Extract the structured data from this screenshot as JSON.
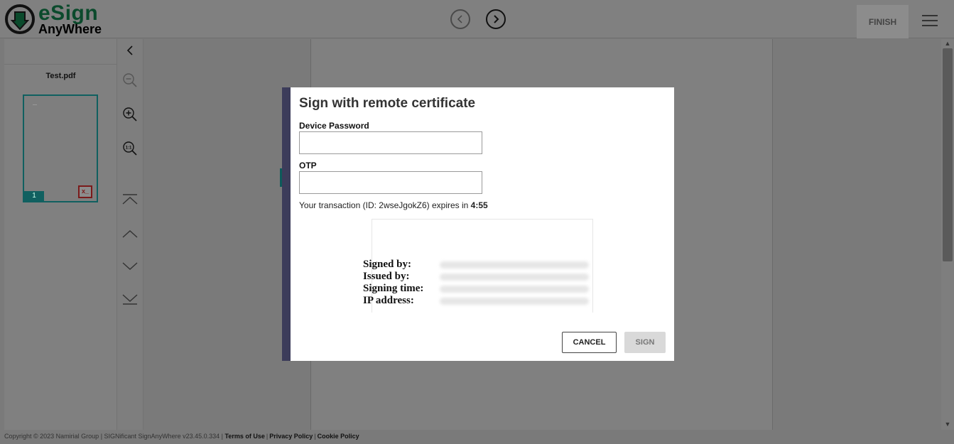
{
  "header": {
    "logo_line1": "eSign",
    "logo_line2": "AnyWhere",
    "finish_label": "FINISH"
  },
  "sidebar": {
    "file_name": "Test.pdf",
    "page_number": "1"
  },
  "icons": {
    "collapse": "chevron-left-icon",
    "zoom_out": "zoom-out-icon",
    "zoom_in": "zoom-in-icon",
    "zoom_reset": "zoom-reset-icon",
    "first_page": "first-page-icon",
    "prev_page": "chevron-up-icon",
    "next_page": "chevron-down-icon",
    "last_page": "last-page-icon"
  },
  "modal": {
    "title": "Sign with remote certificate",
    "password_label": "Device Password",
    "password_value": "",
    "otp_label": "OTP",
    "otp_value": "",
    "expiry_prefix": "Your transaction (ID: 2wseJgokZ6) expires in ",
    "expiry_time": "4:55",
    "signature_keys": [
      "Signed by:",
      "Issued by:",
      "Signing time:",
      "IP address:"
    ],
    "cancel_label": "CANCEL",
    "sign_label": "SIGN"
  },
  "footer": {
    "copyright": "Copyright © 2023 Namirial Group | SIGNificant SignAnyWhere v23.45.0.334 |",
    "terms": "Terms of Use",
    "privacy": "Privacy Policy",
    "cookie": "Cookie Policy"
  },
  "colors": {
    "brand_green": "#0b4a2c",
    "modal_accent": "#3c3c5a",
    "thumb_teal": "#106060"
  }
}
